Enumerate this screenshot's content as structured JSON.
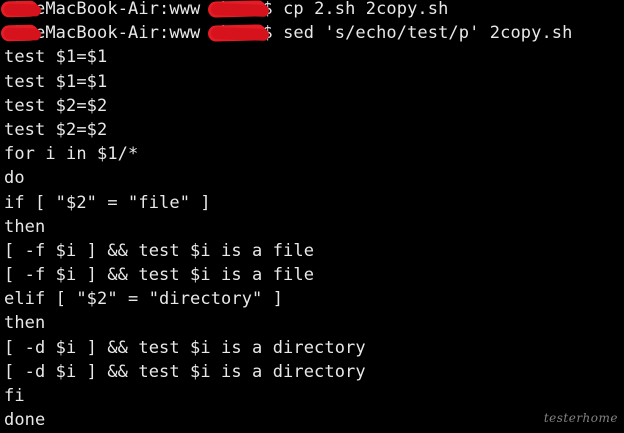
{
  "colors": {
    "background": "#000000",
    "text": "#e8e8e8",
    "redaction": "#e41c25"
  },
  "terminal": {
    "prompts": [
      {
        "host_suffix": "eMacBook-Air:www",
        "command": "cp 2.sh 2copy.sh",
        "user_redacted": true
      },
      {
        "host_suffix": "eMacBook-Air:www",
        "command": "sed 's/echo/test/p' 2copy.sh",
        "user_redacted": true
      }
    ],
    "output_lines": [
      "test $1=$1",
      "test $1=$1",
      "test $2=$2",
      "test $2=$2",
      "for i in $1/*",
      "do",
      "if [ \"$2\" = \"file\" ]",
      "then",
      "[ -f $i ] && test $i is a file",
      "[ -f $i ] && test $i is a file",
      "elif [ \"$2\" = \"directory\" ]",
      "then",
      "[ -d $i ] && test $i is a directory",
      "[ -d $i ] && test $i is a directory",
      "fi",
      "done"
    ]
  },
  "watermark": {
    "text": "testerhome"
  }
}
